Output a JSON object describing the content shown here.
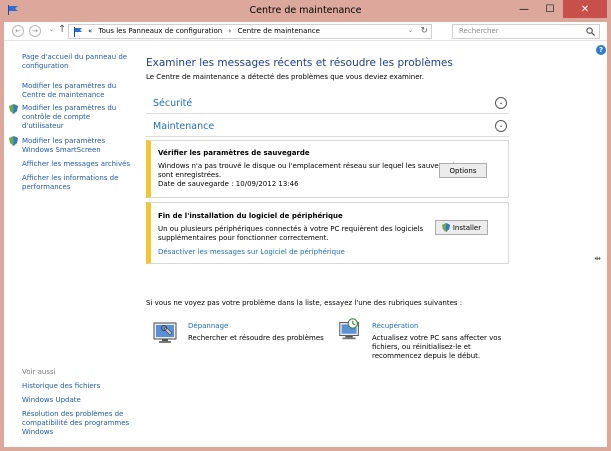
{
  "window": {
    "title": "Centre de maintenance",
    "controls": {
      "minimize": "—",
      "maximize": "☐",
      "close": "✕"
    }
  },
  "addressbar": {
    "back": "←",
    "forward": "→",
    "down": "⌄",
    "up": "↑",
    "path_prefix": "«",
    "crumb1": "Tous les Panneaux de configuration",
    "sep": "›",
    "crumb2": "Centre de maintenance",
    "dropdown": "⌄",
    "refresh": "↻",
    "search_placeholder": "Rechercher"
  },
  "leftnav": {
    "home": [
      "Page d'accueil du panneau de",
      "configuration"
    ],
    "items": [
      [
        "Modifier les paramètres du",
        "Centre de maintenance"
      ],
      [
        "Modifier les paramètres du",
        "contrôle de compte",
        "d'utilisateur"
      ],
      [
        "Modifier les paramètres",
        "Windows SmartScreen"
      ],
      [
        "Afficher les messages archivés"
      ],
      [
        "Afficher les informations de",
        "performances"
      ]
    ],
    "see_also": "Voir aussi",
    "see_also_items": [
      [
        "Historique des fichiers"
      ],
      [
        "Windows Update"
      ],
      [
        "Résolution des problèmes de",
        "compatibilité des programmes",
        "Windows"
      ]
    ]
  },
  "main": {
    "help": "?",
    "title": "Examiner les messages récents et résoudre les problèmes",
    "subtitle": "Le Centre de maintenance a détecté des problèmes que vous deviez examiner.",
    "sections": {
      "security": "Sécurité",
      "maintenance": "Maintenance",
      "chevron": "⌄"
    },
    "msg1": {
      "title": "Vérifier les paramètres de sauvegarde",
      "lines": [
        "Windows n'a pas trouvé le disque ou l'emplacement réseau sur lequel les sauvegardes",
        "sont enregistrées.",
        "Date de sauvegarde : 10/09/2012 13:46"
      ],
      "button": "Options"
    },
    "msg2": {
      "title": "Fin de l'installation du logiciel de périphérique",
      "lines": [
        "Un ou plusieurs périphériques connectés à votre PC requièrent des logiciels",
        "supplémentaires pour fonctionner correctement."
      ],
      "link": "Désactiver les messages sur Logiciel de périphérique",
      "button": "Installer"
    },
    "hint": "Si vous ne voyez pas votre problème dans la liste, essayez l'une des rubriques suivantes :",
    "tool1": {
      "title": "Dépannage",
      "lines": [
        "Rechercher et résoudre des problèmes"
      ]
    },
    "tool2": {
      "title": "Récupération",
      "lines": [
        "Actualisez votre PC sans affecter vos",
        "fichiers, ou réinitialisez-le et",
        "recommencez depuis le début."
      ]
    }
  },
  "colors": {
    "frame": "#dba89b",
    "link": "#1e5aa8",
    "title": "#1e3f8a",
    "warning": "#f3c530",
    "close": "#c7504a"
  }
}
